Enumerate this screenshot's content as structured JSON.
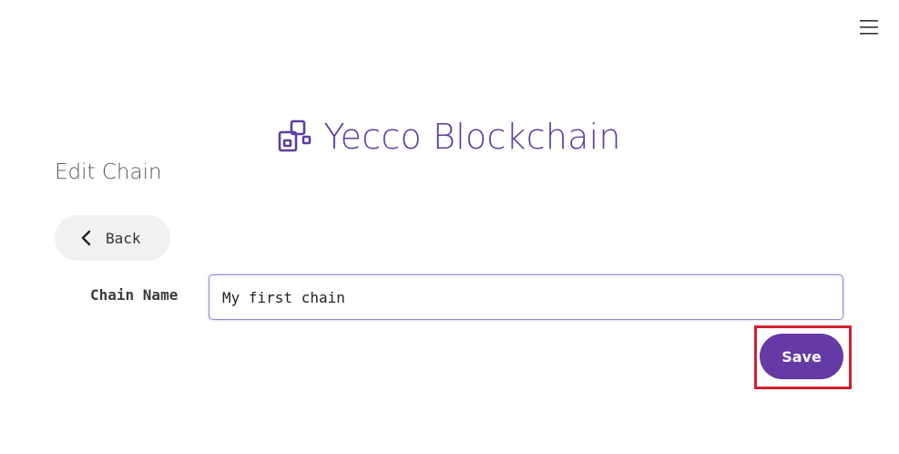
{
  "header": {
    "menu_icon": "hamburger-menu-icon"
  },
  "brand": {
    "logo_icon": "blockchain-blocks-icon",
    "title": "Yecco Blockchain",
    "color": "#5e3ca0"
  },
  "page": {
    "section_title": "Edit Chain"
  },
  "back_button": {
    "icon": "chevron-left-icon",
    "label": "Back"
  },
  "form": {
    "chain_name_label": "Chain Name",
    "chain_name_value": "My first chain"
  },
  "save_button": {
    "label": "Save",
    "color": "#653aa4",
    "highlight_color": "#d1202f"
  }
}
